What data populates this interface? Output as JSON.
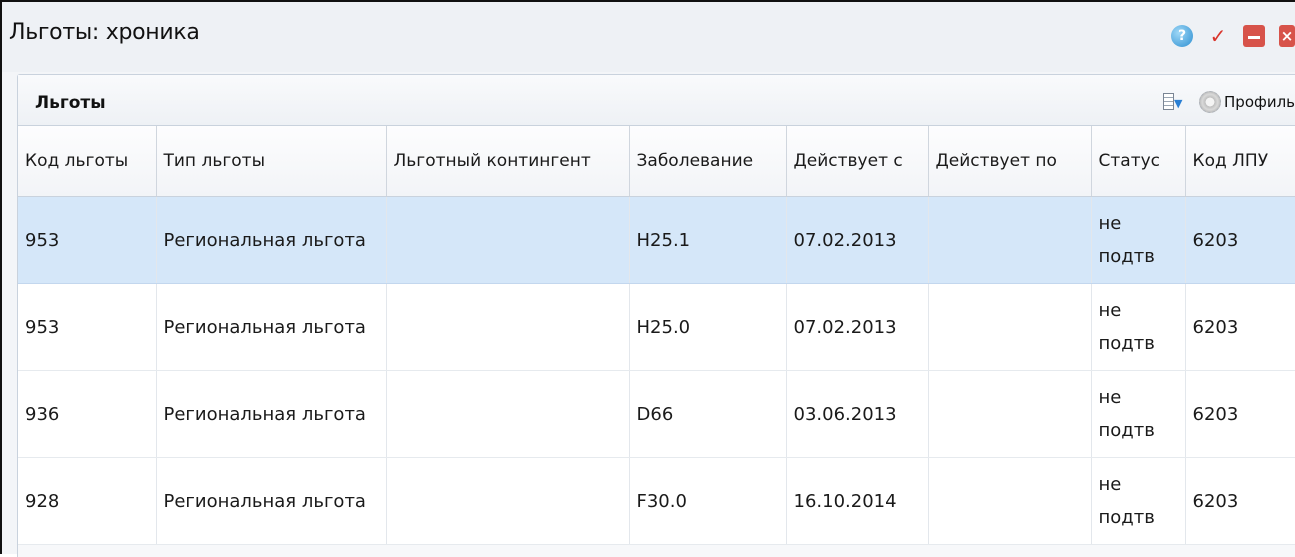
{
  "window": {
    "title": "Льготы: хроника"
  },
  "panel": {
    "title": "Льготы",
    "profile_label": "Профиль"
  },
  "table": {
    "columns": [
      {
        "label": "Код льготы"
      },
      {
        "label": "Тип льготы"
      },
      {
        "label": "Льготный контингент"
      },
      {
        "label": "Заболевание"
      },
      {
        "label": "Действует с"
      },
      {
        "label": "Действует по"
      },
      {
        "label": "Статус"
      },
      {
        "label": "Код ЛПУ"
      }
    ],
    "rows": [
      {
        "code": "953",
        "type": "Региональная льгота",
        "contingent": "",
        "disease": "H25.1",
        "from": "07.02.2013",
        "to": "",
        "status": "не подтв",
        "lpu": "6203",
        "selected": true
      },
      {
        "code": "953",
        "type": "Региональная льгота",
        "contingent": "",
        "disease": "H25.0",
        "from": "07.02.2013",
        "to": "",
        "status": "не подтв",
        "lpu": "6203",
        "selected": false
      },
      {
        "code": "936",
        "type": "Региональная льгота",
        "contingent": "",
        "disease": "D66",
        "from": "03.06.2013",
        "to": "",
        "status": "не подтв",
        "lpu": "6203",
        "selected": false
      },
      {
        "code": "928",
        "type": "Региональная льгота",
        "contingent": "",
        "disease": "F30.0",
        "from": "16.10.2014",
        "to": "",
        "status": "не подтв",
        "lpu": "6203",
        "selected": false
      }
    ]
  },
  "icons": {
    "help": "help-icon",
    "confirm": "checkmark-icon",
    "minimize": "minimize-icon",
    "close": "close-icon",
    "columns": "columns-menu-icon",
    "profile": "gear-icon"
  },
  "colors": {
    "selected_row": "#d5e7f9",
    "window_button": "#d7534a",
    "check": "#d9342b"
  }
}
